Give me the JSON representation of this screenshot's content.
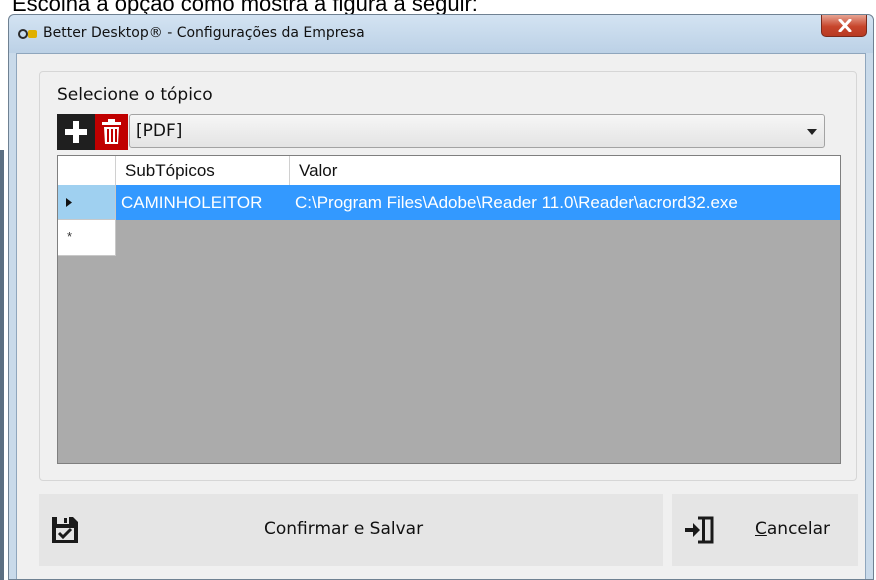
{
  "background_caption": "Escolha a opção como mostra a figura a seguir:",
  "window": {
    "title": "Better Desktop® - Configurações da Empresa",
    "close_icon": "close-icon"
  },
  "topic": {
    "label": "Selecione o tópico",
    "add_icon": "plus-icon",
    "delete_icon": "trash-icon",
    "selected": "[PDF]"
  },
  "grid": {
    "columns": [
      "SubTópicos",
      "Valor"
    ],
    "rows": [
      {
        "subtopico": "CAMINHOLEITOR",
        "valor": "C:\\Program Files\\Adobe\\Reader 11.0\\Reader\\acrord32.exe",
        "selected": true
      }
    ],
    "new_row_marker": "*"
  },
  "buttons": {
    "confirm": "Confirmar e Salvar",
    "cancel_prefix": "C",
    "cancel_rest": "ancelar"
  },
  "colors": {
    "selection": "#3399ff",
    "delete_button": "#c00000",
    "add_button": "#1f1f1f"
  }
}
